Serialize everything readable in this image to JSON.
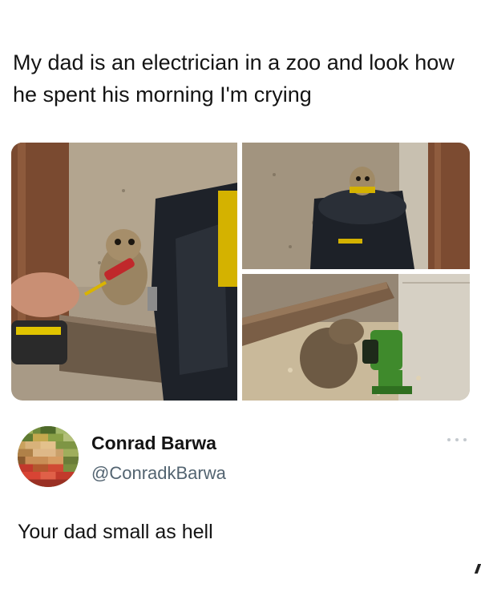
{
  "post": {
    "caption": "My dad is an electrician in a zoo and look how he spent his morning I'm crying"
  },
  "photos": [
    {
      "icon": "meerkat-with-screwdriver-photo"
    },
    {
      "icon": "meerkat-in-tool-bag-photo"
    },
    {
      "icon": "meerkat-with-green-tool-photo"
    }
  ],
  "tweet": {
    "display_name": "Conrad Barwa",
    "handle": "@ConradkBarwa",
    "text": "Your dad small as hell",
    "avatar_icon": "pixelated-avatar",
    "more_icon": "more-options-icon"
  },
  "colors": {
    "text": "#141414",
    "handle": "#536471",
    "background": "#ffffff"
  }
}
